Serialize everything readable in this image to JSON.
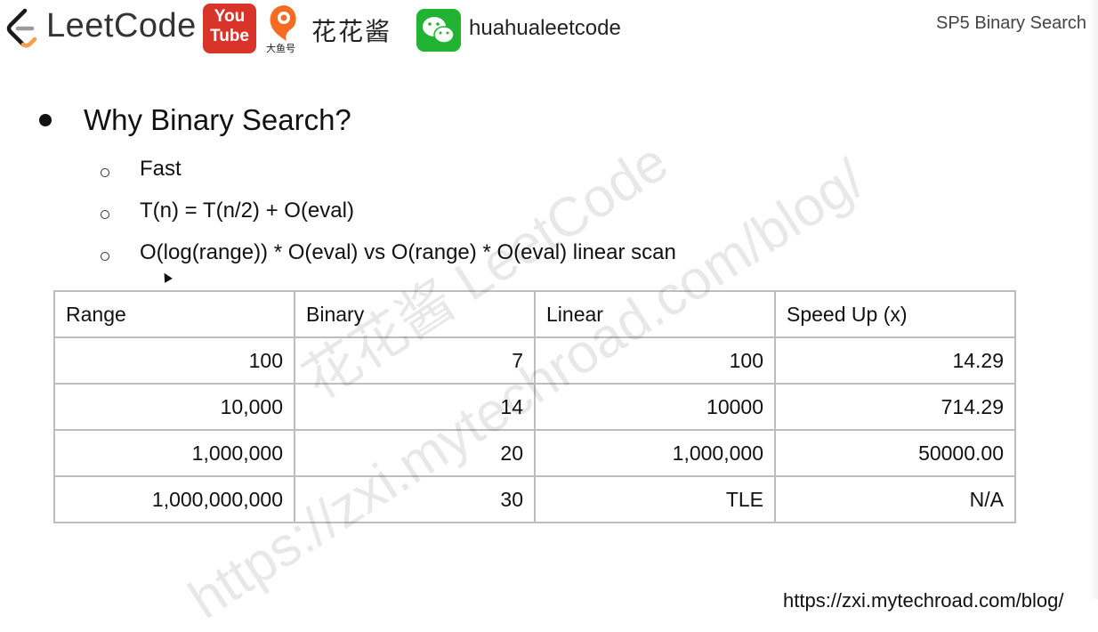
{
  "header": {
    "brand_name": "LeetCode",
    "youtube_line1": "You",
    "youtube_line2": "Tube",
    "douyu_label": "大鱼号",
    "channel_name_cn": "花花酱",
    "wechat_account": "huahualeetcode",
    "slide_section": "SP5 Binary Search",
    "colors": {
      "youtube": "#d8342a",
      "wechat": "#21b333",
      "douyu": "#f36c21",
      "leetcode_orange": "#f0a14a"
    }
  },
  "content": {
    "title": "Why Binary Search?",
    "bullets": [
      "Fast",
      "T(n) = T(n/2) + O(eval)",
      "O(log(range)) * O(eval) vs O(range) * O(eval) linear scan"
    ]
  },
  "table": {
    "headers": [
      "Range",
      "Binary",
      "Linear",
      "Speed Up (x)"
    ],
    "rows": [
      [
        "100",
        "7",
        "100",
        "14.29"
      ],
      [
        "10,000",
        "14",
        "10000",
        "714.29"
      ],
      [
        "1,000,000",
        "20",
        "1,000,000",
        "50000.00"
      ],
      [
        "1,000,000,000",
        "30",
        "TLE",
        "N/A"
      ]
    ]
  },
  "watermark": {
    "line1": "花花酱 LeetCode",
    "line2": "https://zxi.mytechroad.com/blog/"
  },
  "footer": {
    "url_partial": "https://zxi.mytechroad.com/blog/"
  }
}
